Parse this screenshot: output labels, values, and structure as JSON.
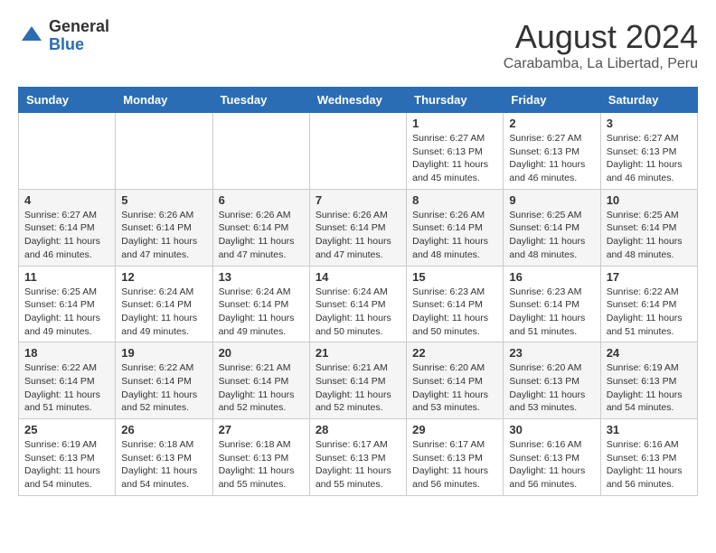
{
  "header": {
    "logo_general": "General",
    "logo_blue": "Blue",
    "month_title": "August 2024",
    "location": "Carabamba, La Libertad, Peru"
  },
  "days_of_week": [
    "Sunday",
    "Monday",
    "Tuesday",
    "Wednesday",
    "Thursday",
    "Friday",
    "Saturday"
  ],
  "weeks": [
    [
      {
        "day": "",
        "info": ""
      },
      {
        "day": "",
        "info": ""
      },
      {
        "day": "",
        "info": ""
      },
      {
        "day": "",
        "info": ""
      },
      {
        "day": "1",
        "info": "Sunrise: 6:27 AM\nSunset: 6:13 PM\nDaylight: 11 hours and 45 minutes."
      },
      {
        "day": "2",
        "info": "Sunrise: 6:27 AM\nSunset: 6:13 PM\nDaylight: 11 hours and 46 minutes."
      },
      {
        "day": "3",
        "info": "Sunrise: 6:27 AM\nSunset: 6:13 PM\nDaylight: 11 hours and 46 minutes."
      }
    ],
    [
      {
        "day": "4",
        "info": "Sunrise: 6:27 AM\nSunset: 6:14 PM\nDaylight: 11 hours and 46 minutes."
      },
      {
        "day": "5",
        "info": "Sunrise: 6:26 AM\nSunset: 6:14 PM\nDaylight: 11 hours and 47 minutes."
      },
      {
        "day": "6",
        "info": "Sunrise: 6:26 AM\nSunset: 6:14 PM\nDaylight: 11 hours and 47 minutes."
      },
      {
        "day": "7",
        "info": "Sunrise: 6:26 AM\nSunset: 6:14 PM\nDaylight: 11 hours and 47 minutes."
      },
      {
        "day": "8",
        "info": "Sunrise: 6:26 AM\nSunset: 6:14 PM\nDaylight: 11 hours and 48 minutes."
      },
      {
        "day": "9",
        "info": "Sunrise: 6:25 AM\nSunset: 6:14 PM\nDaylight: 11 hours and 48 minutes."
      },
      {
        "day": "10",
        "info": "Sunrise: 6:25 AM\nSunset: 6:14 PM\nDaylight: 11 hours and 48 minutes."
      }
    ],
    [
      {
        "day": "11",
        "info": "Sunrise: 6:25 AM\nSunset: 6:14 PM\nDaylight: 11 hours and 49 minutes."
      },
      {
        "day": "12",
        "info": "Sunrise: 6:24 AM\nSunset: 6:14 PM\nDaylight: 11 hours and 49 minutes."
      },
      {
        "day": "13",
        "info": "Sunrise: 6:24 AM\nSunset: 6:14 PM\nDaylight: 11 hours and 49 minutes."
      },
      {
        "day": "14",
        "info": "Sunrise: 6:24 AM\nSunset: 6:14 PM\nDaylight: 11 hours and 50 minutes."
      },
      {
        "day": "15",
        "info": "Sunrise: 6:23 AM\nSunset: 6:14 PM\nDaylight: 11 hours and 50 minutes."
      },
      {
        "day": "16",
        "info": "Sunrise: 6:23 AM\nSunset: 6:14 PM\nDaylight: 11 hours and 51 minutes."
      },
      {
        "day": "17",
        "info": "Sunrise: 6:22 AM\nSunset: 6:14 PM\nDaylight: 11 hours and 51 minutes."
      }
    ],
    [
      {
        "day": "18",
        "info": "Sunrise: 6:22 AM\nSunset: 6:14 PM\nDaylight: 11 hours and 51 minutes."
      },
      {
        "day": "19",
        "info": "Sunrise: 6:22 AM\nSunset: 6:14 PM\nDaylight: 11 hours and 52 minutes."
      },
      {
        "day": "20",
        "info": "Sunrise: 6:21 AM\nSunset: 6:14 PM\nDaylight: 11 hours and 52 minutes."
      },
      {
        "day": "21",
        "info": "Sunrise: 6:21 AM\nSunset: 6:14 PM\nDaylight: 11 hours and 52 minutes."
      },
      {
        "day": "22",
        "info": "Sunrise: 6:20 AM\nSunset: 6:14 PM\nDaylight: 11 hours and 53 minutes."
      },
      {
        "day": "23",
        "info": "Sunrise: 6:20 AM\nSunset: 6:13 PM\nDaylight: 11 hours and 53 minutes."
      },
      {
        "day": "24",
        "info": "Sunrise: 6:19 AM\nSunset: 6:13 PM\nDaylight: 11 hours and 54 minutes."
      }
    ],
    [
      {
        "day": "25",
        "info": "Sunrise: 6:19 AM\nSunset: 6:13 PM\nDaylight: 11 hours and 54 minutes."
      },
      {
        "day": "26",
        "info": "Sunrise: 6:18 AM\nSunset: 6:13 PM\nDaylight: 11 hours and 54 minutes."
      },
      {
        "day": "27",
        "info": "Sunrise: 6:18 AM\nSunset: 6:13 PM\nDaylight: 11 hours and 55 minutes."
      },
      {
        "day": "28",
        "info": "Sunrise: 6:17 AM\nSunset: 6:13 PM\nDaylight: 11 hours and 55 minutes."
      },
      {
        "day": "29",
        "info": "Sunrise: 6:17 AM\nSunset: 6:13 PM\nDaylight: 11 hours and 56 minutes."
      },
      {
        "day": "30",
        "info": "Sunrise: 6:16 AM\nSunset: 6:13 PM\nDaylight: 11 hours and 56 minutes."
      },
      {
        "day": "31",
        "info": "Sunrise: 6:16 AM\nSunset: 6:13 PM\nDaylight: 11 hours and 56 minutes."
      }
    ]
  ]
}
